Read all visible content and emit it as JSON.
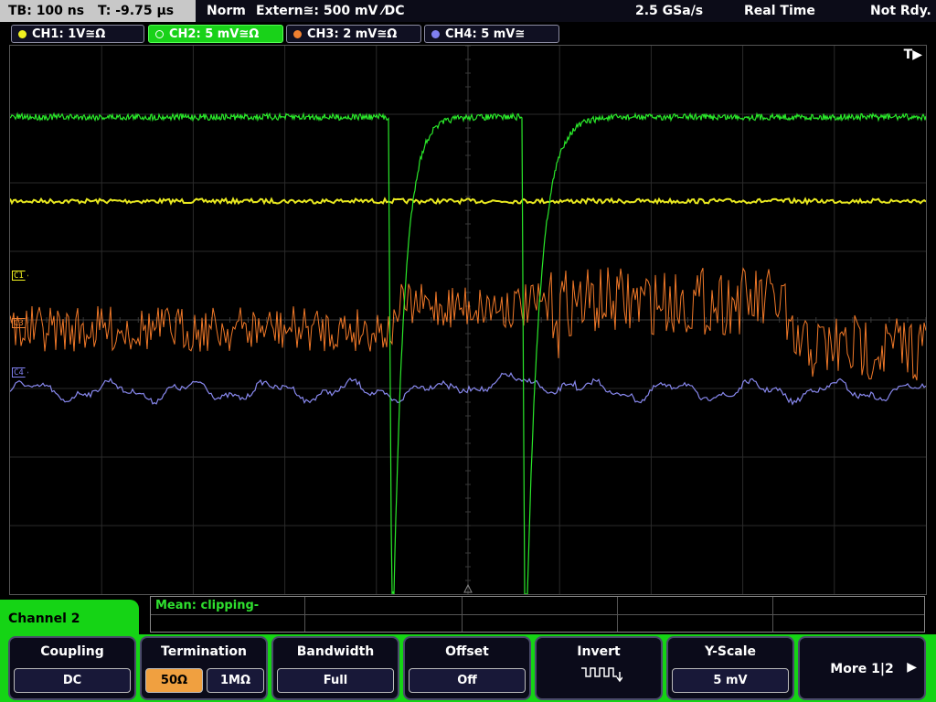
{
  "topbar": {
    "timebase": "TB: 100 ns",
    "trigger_time": "T: -9.75 µs",
    "mode": "Norm",
    "trigger_source": "Extern≅: 500 mV ⁄DC",
    "sample_rate": "2.5 GSa/s",
    "acq_mode": "Real Time",
    "status": "Not Rdy."
  },
  "channels": [
    {
      "label": "CH1: 1V≅Ω",
      "color": "#f0f020"
    },
    {
      "label": "CH2: 5 mV≅Ω",
      "color": "#30ff30"
    },
    {
      "label": "CH3: 2 mV≅Ω",
      "color": "#f08030"
    },
    {
      "label": "CH4: 5 mV≅",
      "color": "#8080f0"
    }
  ],
  "markers": {
    "c1": "C1",
    "c3": "C3",
    "c4": "C4"
  },
  "trigger_flag": "T▶",
  "measurement": {
    "text": "Mean: clipping-"
  },
  "panel": {
    "label": "Channel 2"
  },
  "softkeys": {
    "coupling": {
      "title": "Coupling",
      "value": "DC"
    },
    "termination": {
      "title": "Termination",
      "opt_a": "50Ω",
      "opt_b": "1MΩ"
    },
    "bandwidth": {
      "title": "Bandwidth",
      "value": "Full"
    },
    "offset": {
      "title": "Offset",
      "value": "Off"
    },
    "invert": {
      "title": "Invert"
    },
    "yscale": {
      "title": "Y-Scale",
      "value": "5 mV"
    },
    "more": {
      "title": "More 1|2",
      "arrow": "▶"
    }
  }
}
